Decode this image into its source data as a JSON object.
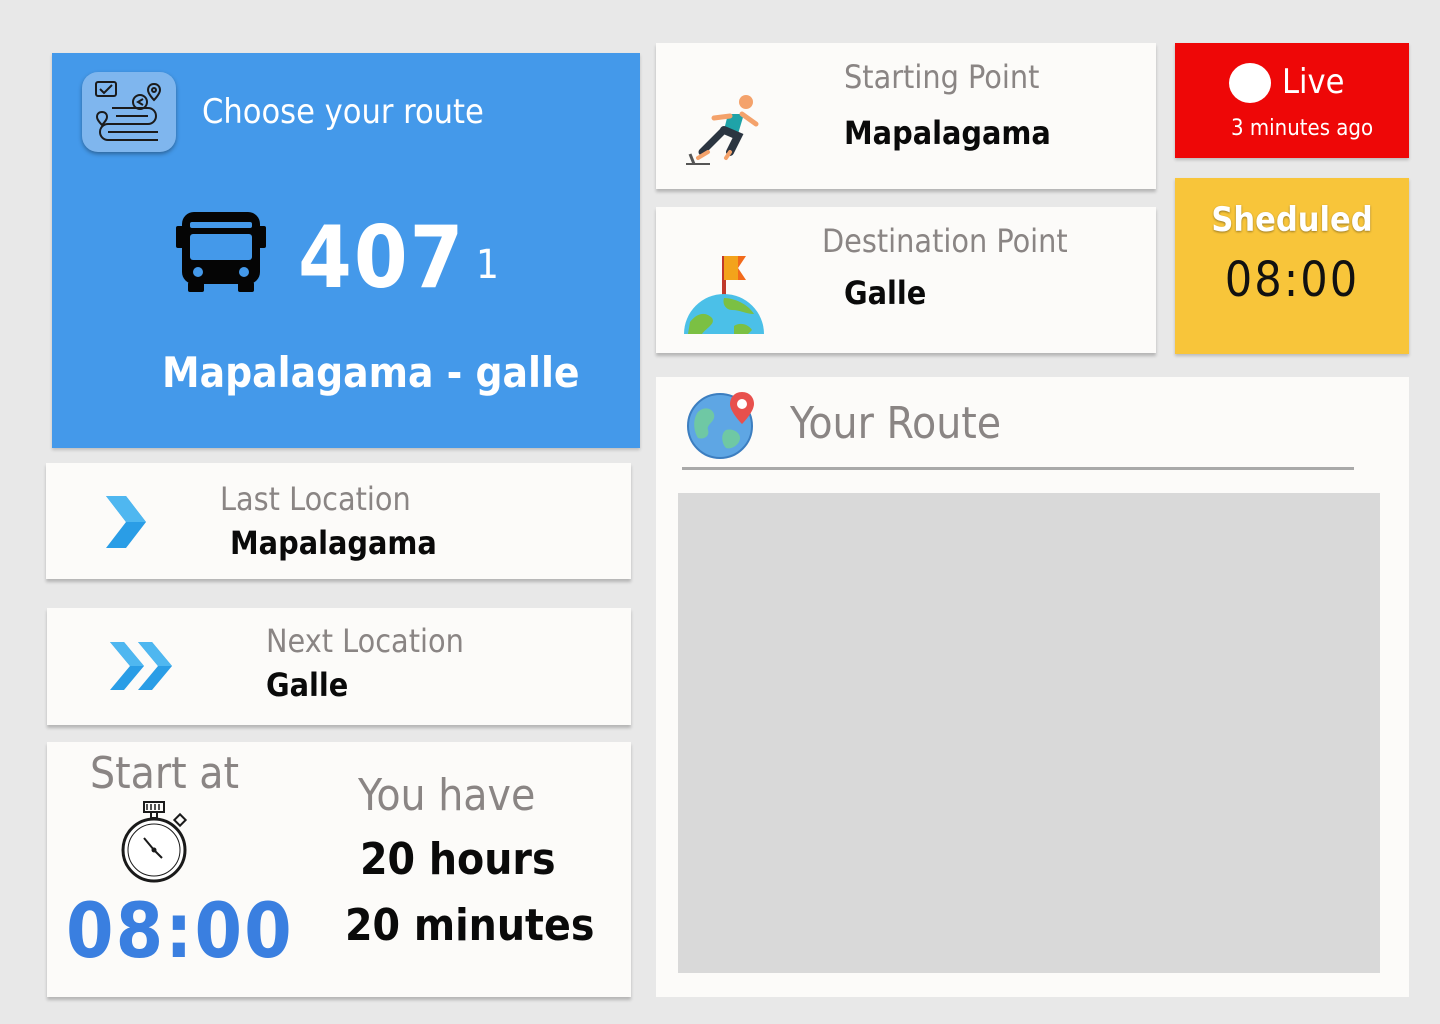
{
  "route": {
    "title": "Choose your route",
    "bus_number": "407",
    "variant": "1",
    "name": "Mapalagama - galle"
  },
  "starting_point": {
    "label": "Starting Point",
    "value": "Mapalagama"
  },
  "destination_point": {
    "label": "Destination Point",
    "value": "Galle"
  },
  "live": {
    "label": "Live",
    "updated": "3 minutes ago"
  },
  "scheduled": {
    "label": "Sheduled",
    "time": "08:00"
  },
  "last_location": {
    "label": "Last Location",
    "value": "Mapalagama"
  },
  "next_location": {
    "label": "Next Location",
    "value": "Galle"
  },
  "start": {
    "label": "Start at",
    "time": "08:00"
  },
  "remaining": {
    "label": "You have",
    "hours": "20 hours",
    "minutes": "20 minutes"
  },
  "your_route": {
    "title": "Your Route"
  },
  "colors": {
    "primary": "#4499ea",
    "live": "#ee0707",
    "scheduled": "#f8c53a",
    "accent_time": "#3a7fe0"
  },
  "icons": [
    "route-map-icon",
    "bus-icon",
    "runner-icon",
    "flag-globe-icon",
    "live-dot-icon",
    "chevron-right-icon",
    "double-chevron-right-icon",
    "stopwatch-icon",
    "globe-pin-icon"
  ]
}
